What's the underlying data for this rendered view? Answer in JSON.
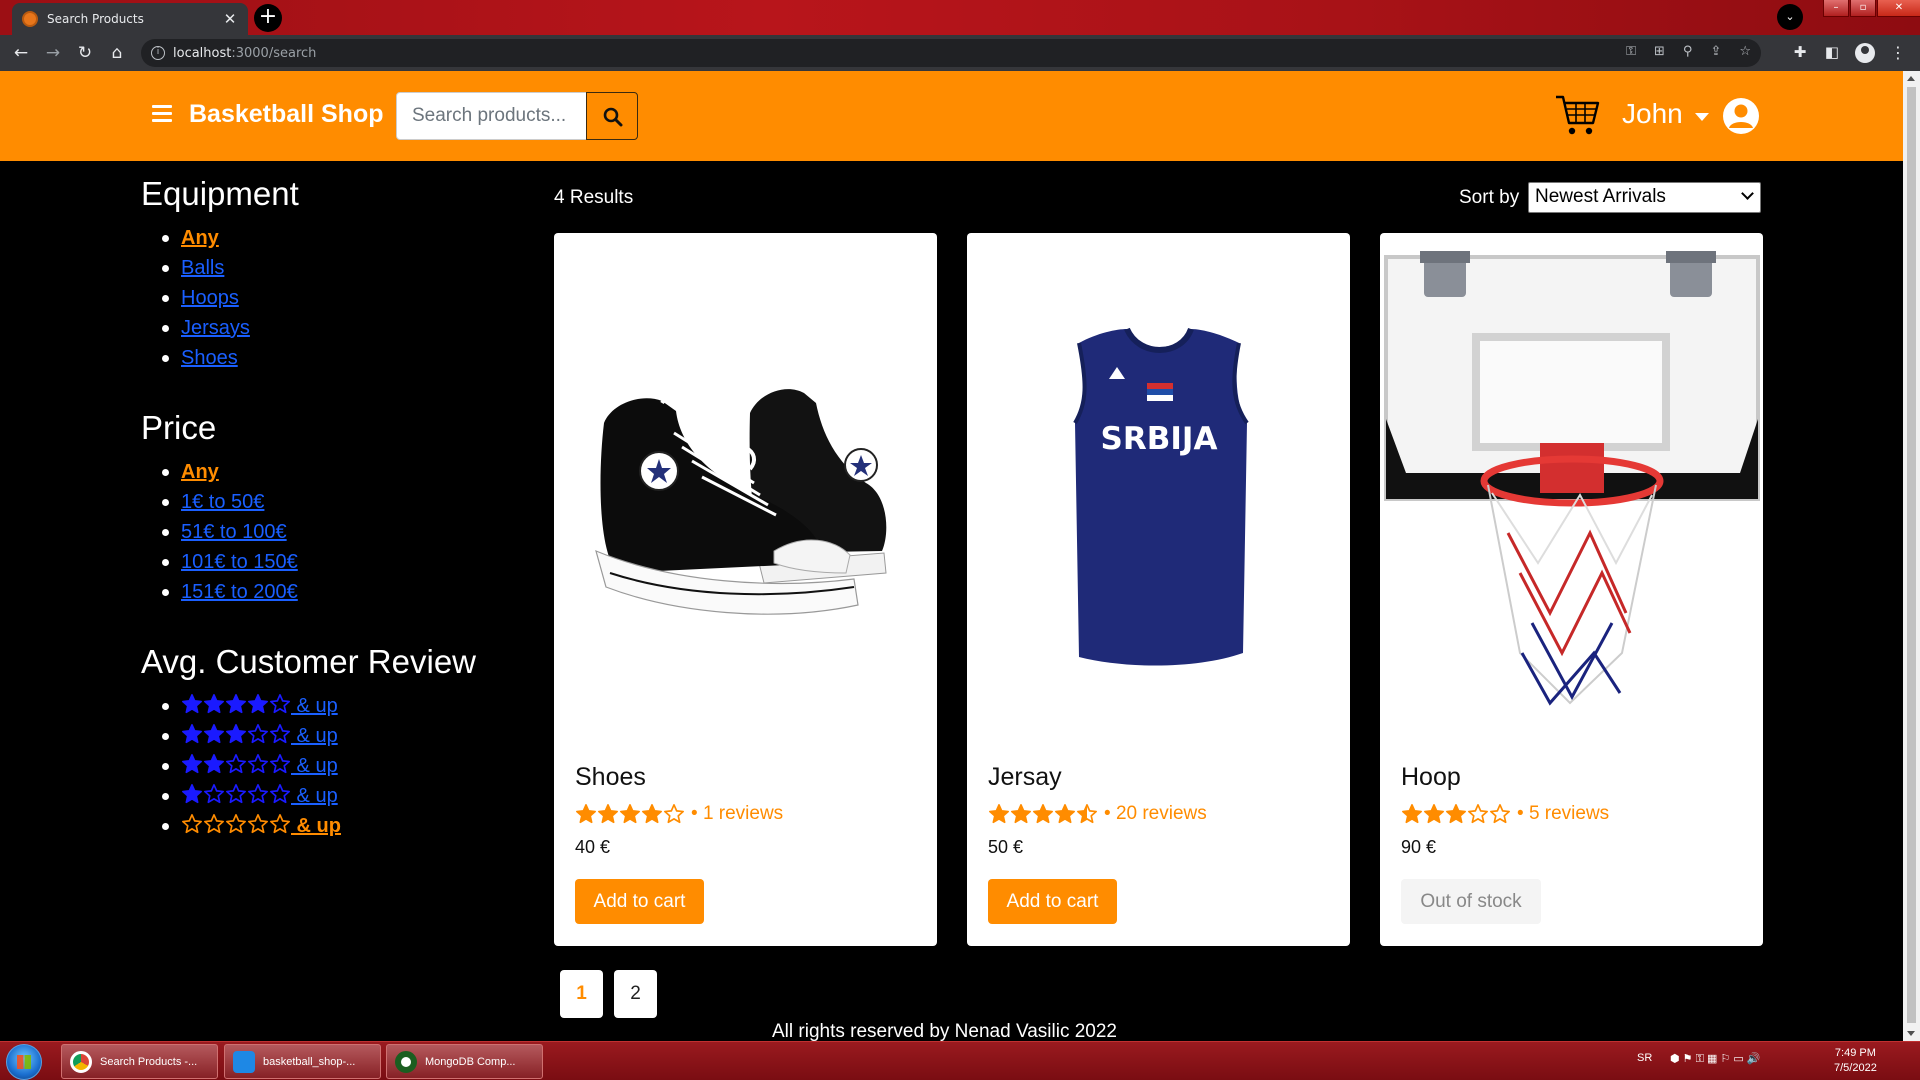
{
  "browser": {
    "tab_title": "Search Products",
    "new_tab_label": "+",
    "url_host": "localhost",
    "url_path": ":3000/search"
  },
  "header": {
    "brand": "Basketball Shop",
    "search_placeholder": "Search products...",
    "user_name": "John"
  },
  "colors": {
    "brand_orange": "#ff8c00",
    "link_blue": "#1a5fff",
    "background": "#000000"
  },
  "sidebar": {
    "equipment": {
      "heading": "Equipment",
      "items": [
        {
          "label": "Any",
          "active": true
        },
        {
          "label": "Balls"
        },
        {
          "label": "Hoops"
        },
        {
          "label": "Jersays"
        },
        {
          "label": "Shoes"
        }
      ]
    },
    "price": {
      "heading": "Price",
      "items": [
        {
          "label": "Any",
          "active": true
        },
        {
          "label": "1€ to 50€"
        },
        {
          "label": "51€ to 100€"
        },
        {
          "label": "101€ to 150€"
        },
        {
          "label": "151€ to 200€"
        }
      ]
    },
    "review": {
      "heading": "Avg. Customer Review",
      "up_label": " & up",
      "items": [
        {
          "stars": 4
        },
        {
          "stars": 3
        },
        {
          "stars": 2
        },
        {
          "stars": 1
        },
        {
          "stars": 0,
          "active": true
        }
      ]
    }
  },
  "results": {
    "count_text": "4 Results",
    "sort_label": "Sort by",
    "sort_value": "Newest Arrivals"
  },
  "products": [
    {
      "name": "Shoes",
      "rating": 4,
      "reviews": "1 reviews",
      "price": "40 €",
      "action": "Add to cart",
      "in_stock": true,
      "image": "sneaker-image"
    },
    {
      "name": "Jersay",
      "rating": 4.5,
      "reviews": "20 reviews",
      "price": "50 €",
      "action": "Add to cart",
      "in_stock": true,
      "image": "jersey-image",
      "jersey_text": "SRBIJA"
    },
    {
      "name": "Hoop",
      "rating": 3,
      "reviews": "5 reviews",
      "price": "90 €",
      "action": "Out of stock",
      "in_stock": false,
      "image": "hoop-image"
    }
  ],
  "pagination": {
    "pages": [
      "1",
      "2"
    ],
    "current": "1"
  },
  "footer": {
    "text": "All rights reserved by Nenad Vasilic 2022"
  },
  "taskbar": {
    "items": [
      "Search Products -...",
      "basketball_shop-...",
      "MongoDB Comp..."
    ],
    "lang": "SR",
    "time": "7:49 PM",
    "date": "7/5/2022"
  }
}
